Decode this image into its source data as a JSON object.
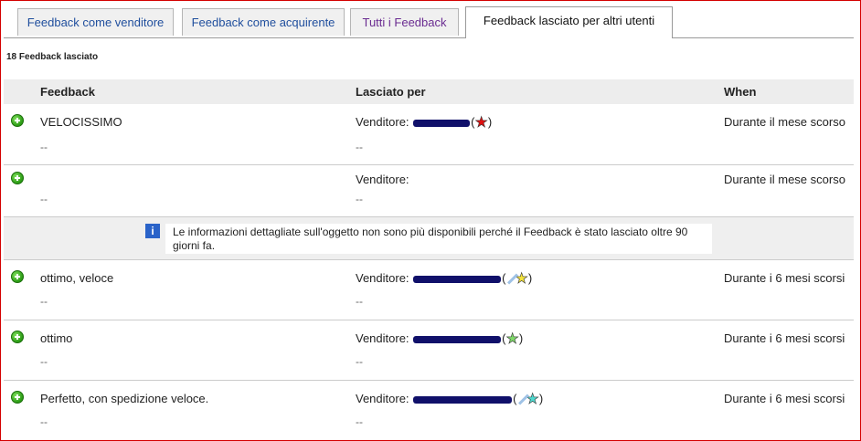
{
  "tabs": [
    {
      "label": "Feedback come venditore"
    },
    {
      "label": "Feedback come acquirente"
    },
    {
      "label": "Tutti i Feedback"
    },
    {
      "label": "Feedback lasciato per altri utenti"
    }
  ],
  "summary": {
    "count_label": "18 Feedback lasciato"
  },
  "table": {
    "headers": {
      "feedback": "Feedback",
      "left_for": "Lasciato per",
      "when": "When"
    }
  },
  "rows": [
    {
      "comment": "VELOCISSIMO",
      "role": "Venditore:",
      "star_color": "#e01010",
      "when": "Durante il mese scorso",
      "item": "--",
      "item2": "--",
      "open_paren": "(",
      "close_paren": ")"
    },
    {
      "comment": "",
      "role": "Venditore:",
      "when": "Durante il mese scorso",
      "item": "--",
      "item2": "--"
    },
    {
      "comment": "ottimo, veloce",
      "role": "Venditore:",
      "star_color": "#f3e33b",
      "when": "Durante i 6 mesi scorsi",
      "item": "--",
      "item2": "--",
      "open_paren": "(",
      "close_paren": ")"
    },
    {
      "comment": "ottimo",
      "role": "Venditore:",
      "star_color": "#7fd86a",
      "when": "Durante i 6 mesi scorsi",
      "item": "--",
      "item2": "--",
      "open_paren": "(",
      "close_paren": ")"
    },
    {
      "comment": "Perfetto, con spedizione veloce.",
      "role": "Venditore:",
      "star_color": "#4fd9cf",
      "when": "Durante i 6 mesi scorsi",
      "item": "--",
      "item2": "--",
      "open_paren": "(",
      "close_paren": ")"
    }
  ],
  "notice": {
    "icon": "i",
    "text": "Le informazioni dettagliate sull'oggetto non sono più disponibili perché il Feedback è stato lasciato oltre 90 giorni fa."
  },
  "colors": {
    "link": "#1f4e9d",
    "visited": "#6a2c91",
    "border": "#d40000",
    "positive": "#2a9a14"
  }
}
